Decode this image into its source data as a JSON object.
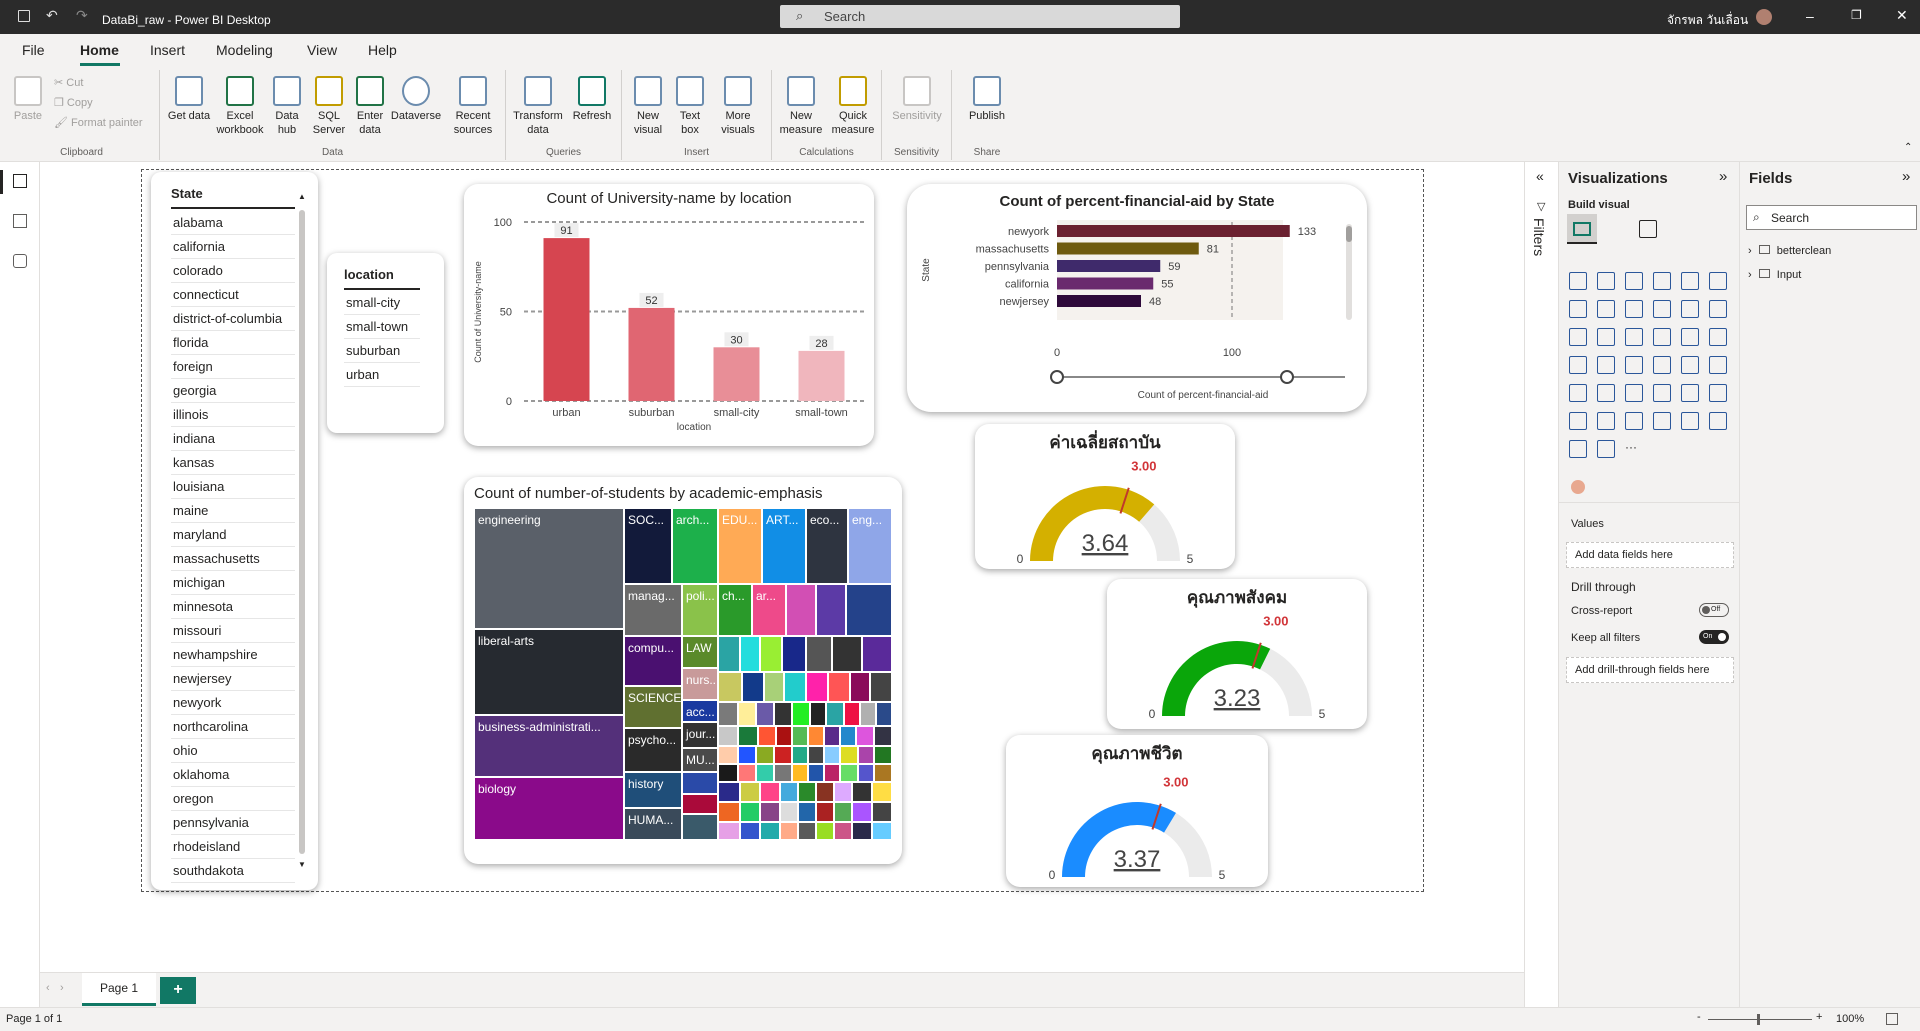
{
  "titlebar": {
    "title": "DataBi_raw - Power BI Desktop",
    "search_placeholder": "Search",
    "user": "จักรพล วันเลื่อน"
  },
  "menu": {
    "items": [
      "File",
      "Home",
      "Insert",
      "Modeling",
      "View",
      "Help"
    ],
    "active": "Home"
  },
  "ribbon": {
    "clipboard": {
      "paste": "Paste",
      "cut": "Cut",
      "copy": "Copy",
      "format_painter": "Format painter",
      "name": "Clipboard"
    },
    "data": {
      "get_data": "Get data",
      "excel": "Excel workbook",
      "hub": "Data hub",
      "sql": "SQL Server",
      "enter": "Enter data",
      "dataverse": "Dataverse",
      "recent": "Recent sources",
      "name": "Data"
    },
    "queries": {
      "transform": "Transform data",
      "refresh": "Refresh",
      "name": "Queries"
    },
    "insert": {
      "new_visual": "New visual",
      "text_box": "Text box",
      "more_visuals": "More visuals",
      "name": "Insert"
    },
    "calculations": {
      "new_measure": "New measure",
      "quick_measure": "Quick measure",
      "name": "Calculations"
    },
    "sensitivity": {
      "label": "Sensitivity",
      "name": "Sensitivity"
    },
    "share": {
      "publish": "Publish",
      "name": "Share"
    }
  },
  "state_slicer": {
    "header": "State",
    "items": [
      "alabama",
      "california",
      "colorado",
      "connecticut",
      "district-of-columbia",
      "florida",
      "foreign",
      "georgia",
      "illinois",
      "indiana",
      "kansas",
      "louisiana",
      "maine",
      "maryland",
      "massachusetts",
      "michigan",
      "minnesota",
      "missouri",
      "newhampshire",
      "newjersey",
      "newyork",
      "northcarolina",
      "ohio",
      "oklahoma",
      "oregon",
      "pennsylvania",
      "rhodeisland",
      "southdakota"
    ]
  },
  "location_slicer": {
    "header": "location",
    "items": [
      "small-city",
      "small-town",
      "suburban",
      "urban"
    ]
  },
  "chart_data": [
    {
      "type": "bar",
      "title": "Count of University-name by location",
      "categories": [
        "urban",
        "suburban",
        "small-city",
        "small-town"
      ],
      "values": [
        91,
        52,
        30,
        28
      ],
      "xlabel": "location",
      "ylabel": "Count of University-name",
      "ylim": [
        0,
        100
      ],
      "yticks": [
        0,
        50,
        100
      ],
      "colors": [
        "#d64550",
        "#e06672",
        "#e88e97",
        "#f0b6bd"
      ]
    },
    {
      "type": "bar",
      "orientation": "horizontal",
      "title": "Count of percent-financial-aid by State",
      "categories": [
        "newyork",
        "massachusetts",
        "pennsylvania",
        "california",
        "newjersey"
      ],
      "values": [
        133,
        81,
        59,
        55,
        48
      ],
      "xlabel": "Count of percent-financial-aid",
      "ylabel": "State",
      "xticks": [
        0,
        100
      ],
      "colors": [
        "#6b2130",
        "#6e5a0f",
        "#3f2a6b",
        "#6a2a6e",
        "#2e0a3a"
      ]
    },
    {
      "type": "treemap",
      "title": "Count of number-of-students by academic-emphasis",
      "labels": [
        "engineering",
        "liberal-arts",
        "business-administrati...",
        "biology",
        "SOC...",
        "arch...",
        "EDU...",
        "ART...",
        "eco...",
        "eng...",
        "manag...",
        "poli...",
        "ch...",
        "ar...",
        "compu...",
        "LAW",
        "nurs...",
        "SCIENCE",
        "acc...",
        "psycho...",
        "jour...",
        "MU...",
        "history",
        "HUMA..."
      ]
    }
  ],
  "gauges": [
    {
      "title": "ค่าเฉลี่ยสถาบัน",
      "value": "3.64",
      "target": "3.00",
      "min": "0",
      "max": "5",
      "fraction": 0.728,
      "target_fraction": 0.6,
      "color": "#d4b000"
    },
    {
      "title": "คุณภาพสังคม",
      "value": "3.23",
      "target": "3.00",
      "min": "0",
      "max": "5",
      "fraction": 0.646,
      "target_fraction": 0.6,
      "color": "#0aa60a"
    },
    {
      "title": "คุณภาพชีวิต",
      "value": "3.37",
      "target": "3.00",
      "min": "0",
      "max": "5",
      "fraction": 0.674,
      "target_fraction": 0.6,
      "color": "#1a8cff"
    }
  ],
  "filters": {
    "label": "Filters"
  },
  "visualizations": {
    "title": "Visualizations",
    "build_visual": "Build visual",
    "values": "Values",
    "add_data": "Add data fields here",
    "drill_through": "Drill through",
    "cross_report": "Cross-report",
    "cross_state": "Off",
    "keep_filters": "Keep all filters",
    "keep_state": "On",
    "add_drill": "Add drill-through fields here"
  },
  "fields": {
    "title": "Fields",
    "search_placeholder": "Search",
    "tables": [
      "betterclean",
      "Input"
    ]
  },
  "pages": {
    "tab": "Page 1",
    "add": "+"
  },
  "status": {
    "page": "Page 1 of 1",
    "zoom": "100%"
  }
}
